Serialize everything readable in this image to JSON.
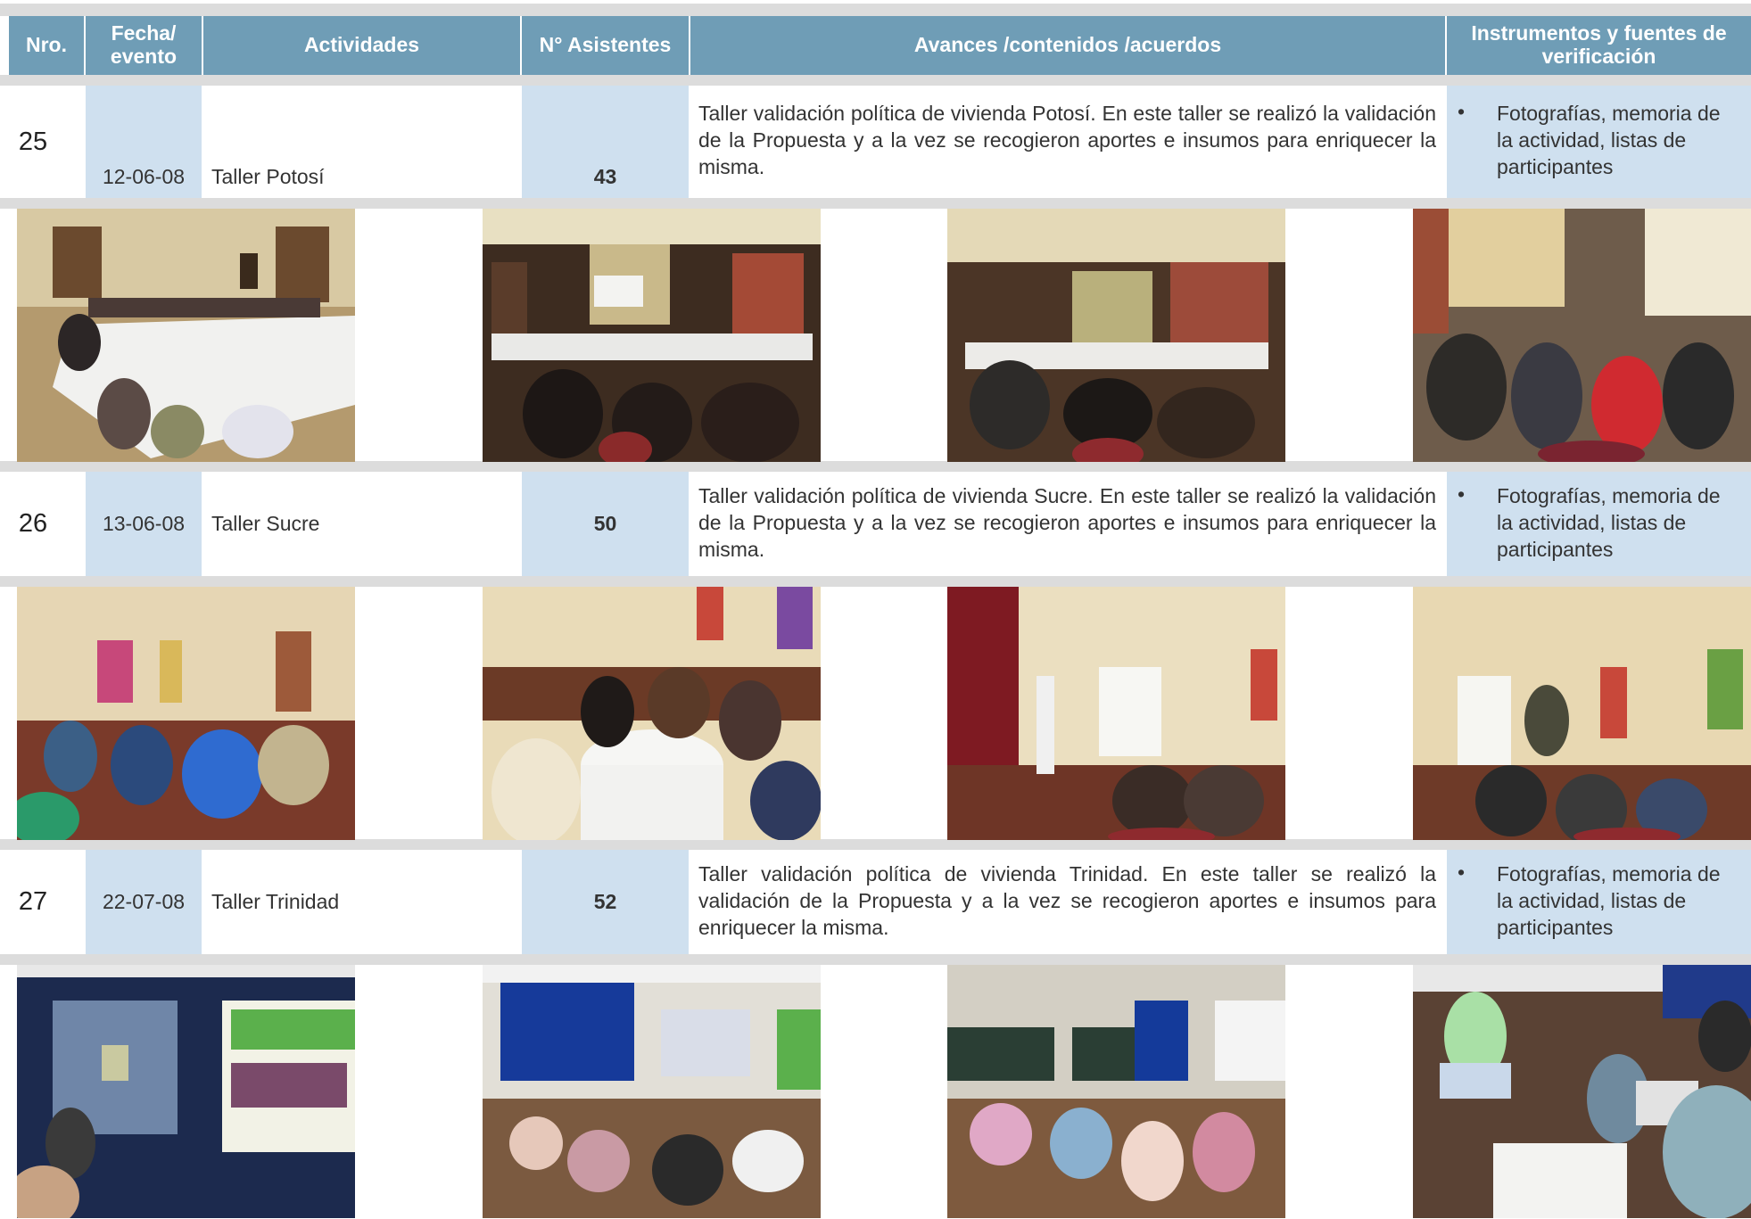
{
  "headers": {
    "nro": "Nro.",
    "fecha": "Fecha/ evento",
    "actividades": "Actividades",
    "asistentes": "N° Asistentes",
    "avances": "Avances /contenidos /acuerdos",
    "instrumentos": "Instrumentos y fuentes de verificación"
  },
  "rows": [
    {
      "nro": "25",
      "fecha": "12-06-08",
      "actividad": "Taller Potosí",
      "asistentes": "43",
      "avances": "Taller validación política de vivienda Potosí. En este taller se realizó la validación de la Propuesta y a la vez se recogieron aportes e insumos para enriquecer la misma.",
      "bullet": "•",
      "instrumentos": "Fotografías, memoria de la actividad, listas de participantes"
    },
    {
      "nro": "26",
      "fecha": "13-06-08",
      "actividad": "Taller Sucre",
      "asistentes": "50",
      "avances": "Taller validación política de vivienda Sucre. En este taller se realizó la validación de la Propuesta y a la vez se recogieron aportes e insumos para enriquecer la misma.",
      "bullet": "•",
      "instrumentos": "Fotografías, memoria de la actividad, listas de participantes"
    },
    {
      "nro": "27",
      "fecha": "22-07-08",
      "actividad": "Taller Trinidad",
      "asistentes": "52",
      "avances": "Taller validación política de vivienda Trinidad. En este taller se realizó la validación de la Propuesta y a la vez se recogieron aportes e insumos para enriquecer la misma.",
      "bullet": "•",
      "instrumentos": "Fotografías, memoria de la actividad, listas de participantes"
    }
  ],
  "colors": {
    "header_bg": "#6f9db6",
    "cell_blue": "#cfe0ef",
    "band_gray": "#dcdcdc"
  }
}
